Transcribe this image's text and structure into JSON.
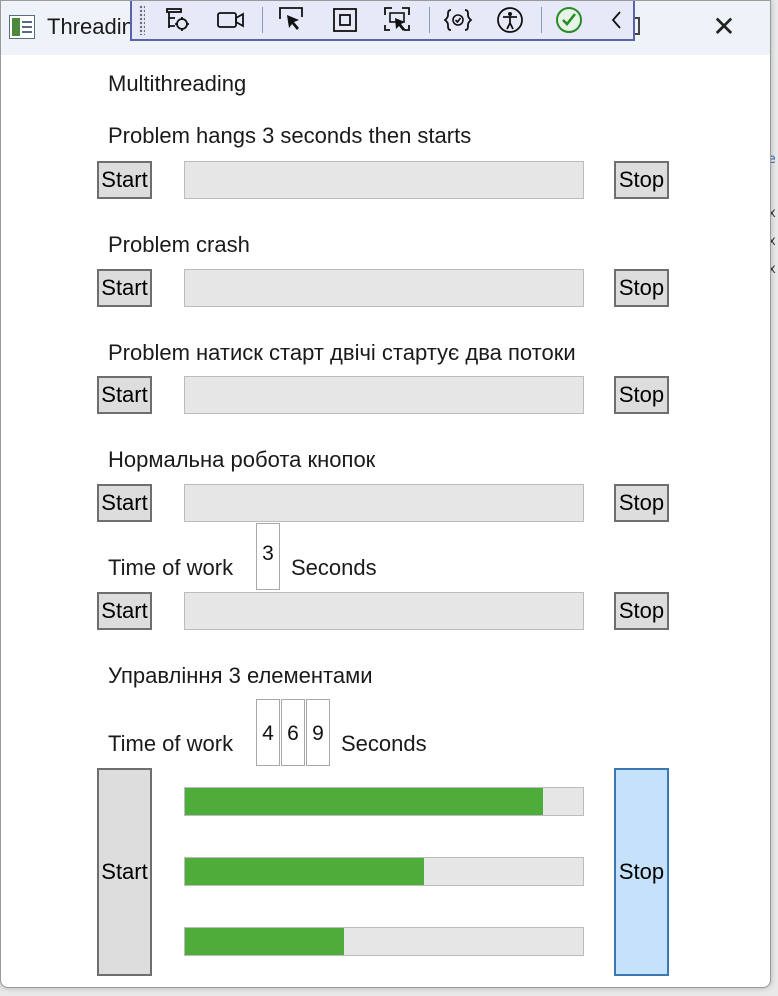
{
  "window": {
    "title": "Threading"
  },
  "colors": {
    "progress_fill": "#4dac3a",
    "track": "#e6e6e6",
    "stop_active": "#c6e2fb",
    "toolbar_border": "#5a63a8"
  },
  "devtools_toolbar": {
    "icons": [
      "grip-handle",
      "live-visual-tree-icon",
      "video-camera-icon",
      "select-element-icon",
      "display-layout-adorners-icon",
      "track-focused-element-icon",
      "binding-failures-icon",
      "accessibility-icon",
      "hot-reload-check-icon",
      "collapse-toolbar-icon"
    ]
  },
  "background_code": [
    "e",
    "x",
    "x",
    "x"
  ],
  "content": {
    "heading": "Multithreading",
    "sections": [
      {
        "label": "Problem hangs 3 seconds then starts",
        "start": "Start",
        "stop": "Stop",
        "progress": 0
      },
      {
        "label": "Problem crash",
        "start": "Start",
        "stop": "Stop",
        "progress": 0
      },
      {
        "label": "Problem натиск старт двічі стартує два потоки",
        "start": "Start",
        "stop": "Stop",
        "progress": 0
      },
      {
        "label": "Нормальна робота кнопок",
        "start": "Start",
        "stop": "Stop",
        "progress": 0
      },
      {
        "label_prefix": "Time of work",
        "seconds_value": "3",
        "label_suffix": "Seconds",
        "start": "Start",
        "stop": "Stop",
        "progress": 0
      }
    ],
    "multi": {
      "title": "Управління 3 елементами",
      "label_prefix": "Time of work",
      "values": [
        "4",
        "6",
        "9"
      ],
      "label_suffix": "Seconds",
      "start": "Start",
      "stop": "Stop",
      "progress": [
        0.9,
        0.6,
        0.4
      ]
    }
  }
}
